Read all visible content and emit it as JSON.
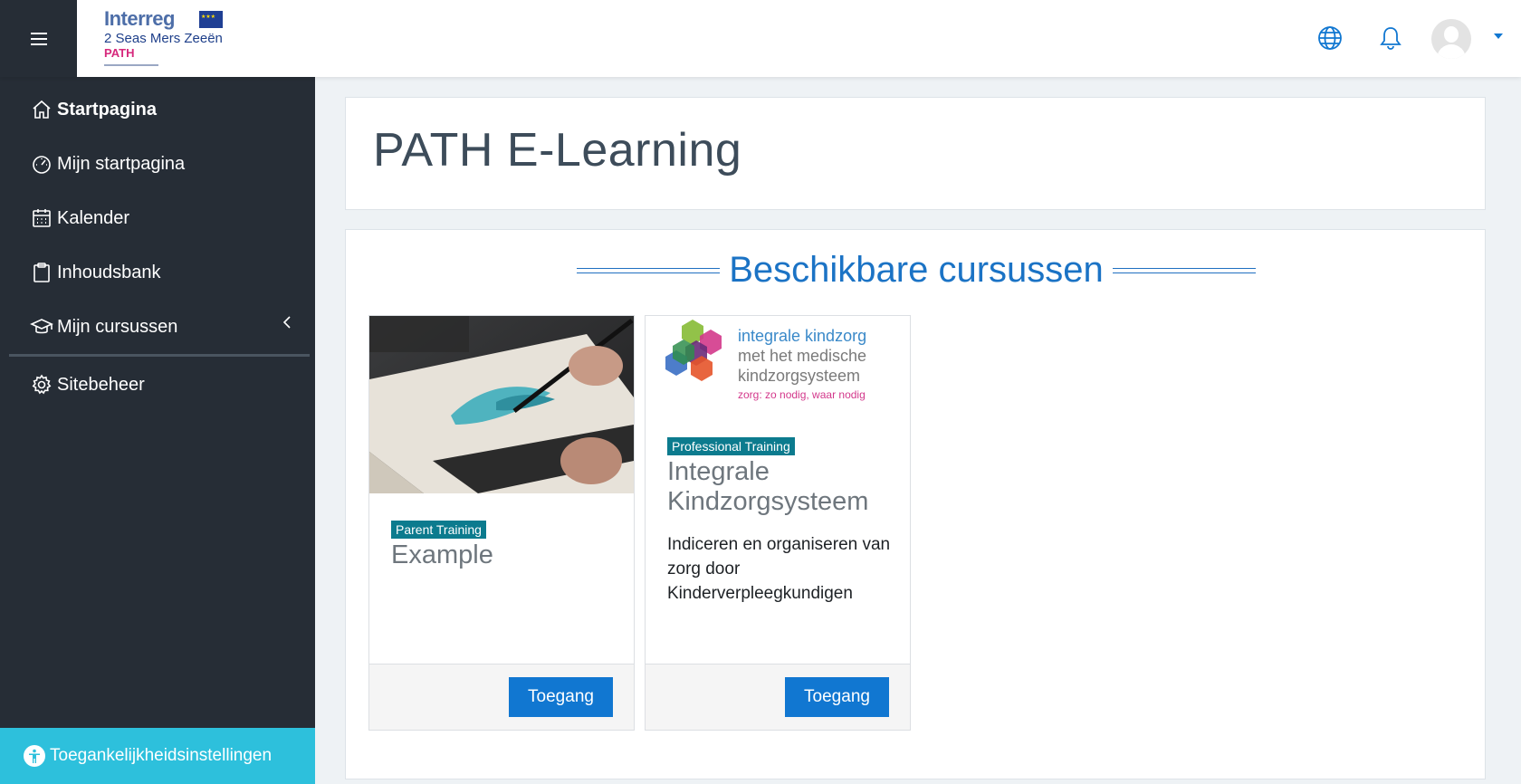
{
  "header": {
    "menu_icon": "hamburger-icon",
    "logo": {
      "line1": "Interreg",
      "line2": "2 Seas Mers Zeeën",
      "line3": "PATH"
    },
    "icons": [
      "globe-icon",
      "bell-icon",
      "user-avatar"
    ]
  },
  "sidebar": {
    "items": [
      {
        "label": "Startpagina",
        "icon": "home-icon"
      },
      {
        "label": "Mijn startpagina",
        "icon": "dashboard-icon"
      },
      {
        "label": "Kalender",
        "icon": "calendar-icon"
      },
      {
        "label": "Inhoudsbank",
        "icon": "clipboard-icon"
      },
      {
        "label": "Mijn cursussen",
        "icon": "graduation-cap-icon"
      },
      {
        "label": "Sitebeheer",
        "icon": "gear-icon"
      }
    ],
    "accessibility_label": "Toegankelijkheidsinstellingen"
  },
  "page": {
    "title": "PATH E-Learning",
    "section_title": "Beschikbare cursussen"
  },
  "courses": [
    {
      "category": "Parent Training",
      "name": "Example",
      "description": "",
      "button": "Toegang"
    },
    {
      "category": "Professional Training",
      "name": "Integrale Kindzorgsysteem",
      "description": "Indiceren en organiseren van zorg door Kinderverpleegkundigen",
      "button": "Toegang",
      "image_text": {
        "l1": "integrale kindzorg",
        "l2": "met het medische",
        "l3": "kindzorgsysteem",
        "l4": "zorg: zo nodig, waar nodig"
      }
    }
  ],
  "colors": {
    "sidebar_bg": "#262d36",
    "accent": "#1177d1",
    "badge": "#0c7b8e",
    "a11y_bar": "#2dc0dc"
  }
}
